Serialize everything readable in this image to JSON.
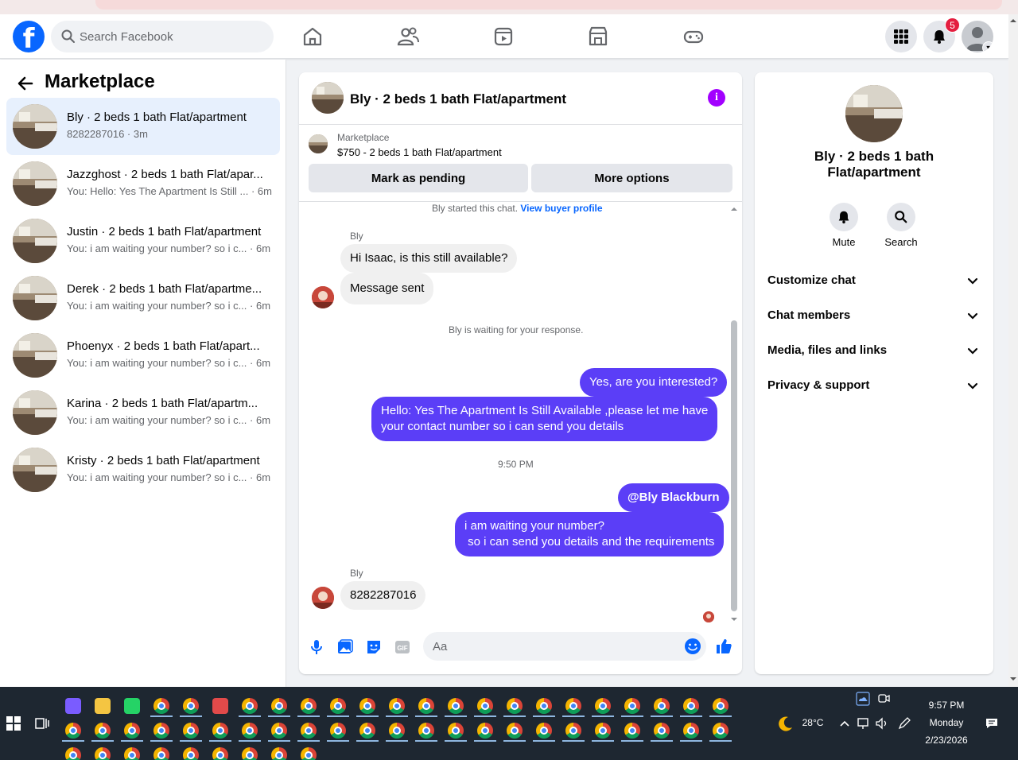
{
  "header": {
    "search_placeholder": "Search Facebook",
    "notification_count": "5",
    "brand_color": "#0866ff"
  },
  "sidebar": {
    "title": "Marketplace",
    "conversations": [
      {
        "title": "Bly · 2 beds 1 bath Flat/apartment",
        "subtitle": "8282287016 · 3m"
      },
      {
        "title": "Jazzghost · 2 beds 1 bath Flat/apar...",
        "subtitle": "You: Hello: Yes The Apartment Is Still ... · 6m"
      },
      {
        "title": "Justin · 2 beds 1 bath Flat/apartment",
        "subtitle": "You: i am waiting your number? so i c... · 6m"
      },
      {
        "title": "Derek · 2 beds 1 bath Flat/apartme...",
        "subtitle": "You: i am waiting your number? so i c... · 6m"
      },
      {
        "title": "Phoenyx · 2 beds 1 bath Flat/apart...",
        "subtitle": "You: i am waiting your number? so i c... · 6m"
      },
      {
        "title": "Karina · 2 beds 1 bath Flat/apartm...",
        "subtitle": "You: i am waiting your number? so i c... · 6m"
      },
      {
        "title": "Kristy · 2 beds 1 bath Flat/apartment",
        "subtitle": "You: i am waiting your number? so i c... · 6m"
      }
    ]
  },
  "chat": {
    "title": "Bly · 2 beds 1 bath Flat/apartment",
    "listing_label": "Marketplace",
    "listing_price": "$750 - 2 beds 1 bath Flat/apartment",
    "mark_pending": "Mark as pending",
    "more_options": "More options",
    "started_text": "Bly started this chat.",
    "view_profile": "View buyer profile",
    "sender_name": "Bly",
    "msg_in_1": "Hi Isaac, is this still available?",
    "msg_in_2": "Message sent",
    "waiting_text": "Bly is waiting for your response.",
    "msg_out_1": "Yes, are you interested?",
    "msg_out_2": "Hello: Yes The Apartment Is Still Available ,please let me have\nyour contact number so i can send you details",
    "time_divider": "9:50 PM",
    "msg_out_3": "@Bly Blackburn",
    "msg_out_4": "i am waiting your number?\n so i can send you details and the requirements",
    "msg_in_3": "8282287016",
    "composer_placeholder": "Aa",
    "accent_color": "#5b3ef7"
  },
  "details": {
    "title": "Bly · 2 beds 1 bath Flat/apartment",
    "mute_label": "Mute",
    "search_label": "Search",
    "sections": [
      "Customize chat",
      "Chat members",
      "Media, files and links",
      "Privacy & support"
    ]
  },
  "taskbar": {
    "temperature": "28°C",
    "time": "9:57 PM",
    "day": "Monday",
    "date": "2/23/2026"
  }
}
